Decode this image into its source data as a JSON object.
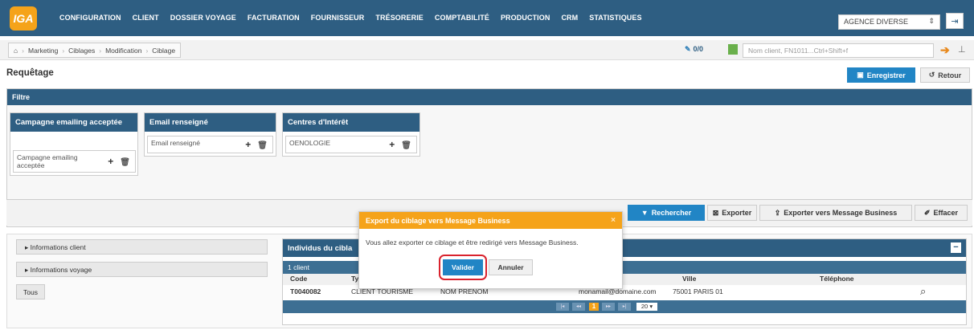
{
  "logo": "IGA",
  "nav": [
    "CONFIGURATION",
    "CLIENT",
    "DOSSIER VOYAGE",
    "FACTURATION",
    "FOURNISSEUR",
    "TRÉSORERIE",
    "COMPTABILITÉ",
    "PRODUCTION",
    "CRM",
    "STATISTIQUES"
  ],
  "agency": {
    "value": "AGENCE DIVERSE"
  },
  "breadcrumb": [
    "Marketing",
    "Ciblages",
    "Modification",
    "Ciblage"
  ],
  "counter": "0/0",
  "search": {
    "placeholder": "Nom client, FN1011...Ctrl+Shift+f"
  },
  "page": {
    "title": "Requêtage",
    "save": "Enregistrer",
    "back": "Retour"
  },
  "filtre": {
    "title": "Filtre",
    "criteria": [
      {
        "title": "Campagne emailing acceptée",
        "item": "Campagne emailing acceptée"
      },
      {
        "title": "Email renseigné",
        "item": "Email renseigné"
      },
      {
        "title": "Centres d'Intérêt",
        "item": "OENOLOGIE"
      }
    ]
  },
  "toolbar": {
    "rechercher": "Rechercher",
    "exporter": "Exporter",
    "exporter_mb": "Exporter vers Message Business",
    "effacer": "Effacer"
  },
  "sidebar": {
    "items": [
      "Informations client",
      "Informations voyage"
    ],
    "tous": "Tous"
  },
  "results": {
    "title": "Individus du cibla",
    "count": "1 client",
    "columns": {
      "code": "Code",
      "type": "Ty",
      "ville": "Ville",
      "telephone": "Téléphone"
    },
    "row": {
      "code": "T0040082",
      "type": "CLIENT TOURISME",
      "nom": "NOM PRENOM",
      "email": "monamail@domaine.com",
      "ville": "75001 PARIS 01"
    },
    "page": "1",
    "page_size": "20 ▾"
  },
  "modal": {
    "title": "Export du ciblage vers Message Business",
    "close": "×",
    "message": "Vous allez exporter ce ciblage et être redirigé vers Message Business.",
    "valider": "Valider",
    "annuler": "Annuler"
  }
}
